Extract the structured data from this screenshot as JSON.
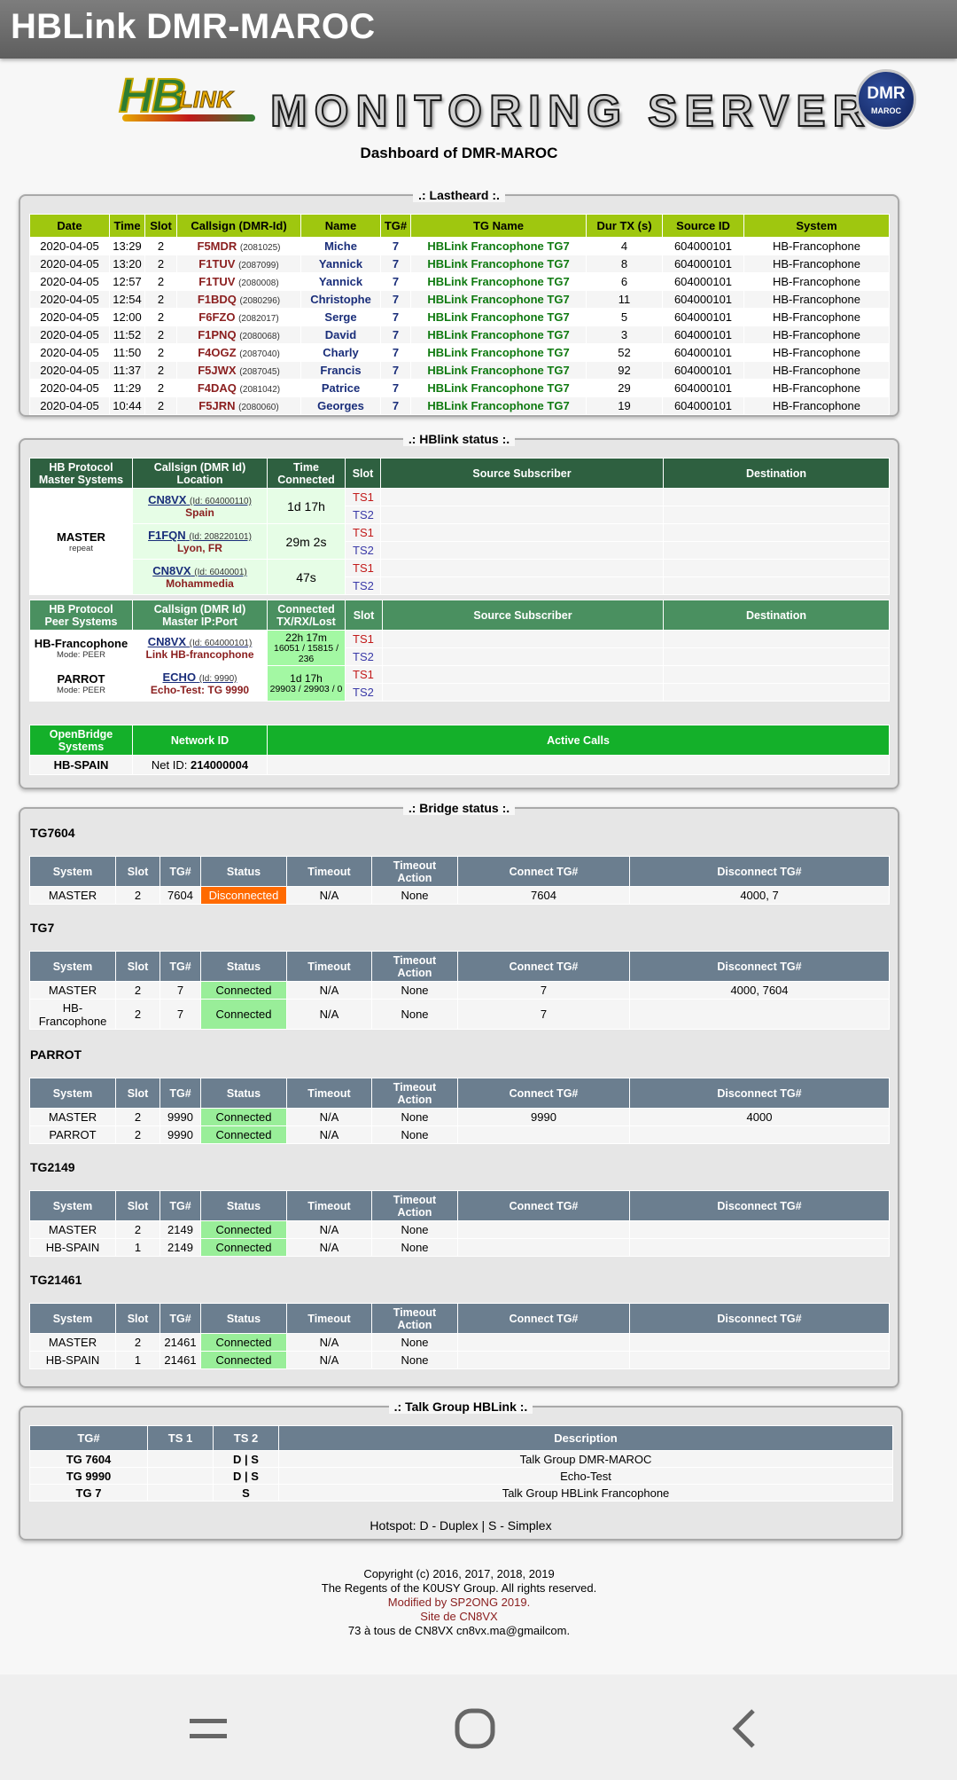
{
  "app_title": "HBLink DMR-MAROC",
  "header": {
    "logo_hb": "HB",
    "logo_link": "LINK",
    "banner": "MONITORING SERVER",
    "badge_top": "DMR",
    "badge_bottom": "MAROC",
    "dashboard_title": "Dashboard of DMR-MAROC"
  },
  "lastheard": {
    "legend": ".: Lastheard :.",
    "columns": [
      "Date",
      "Time",
      "Slot",
      "Callsign (DMR-Id)",
      "Name",
      "TG#",
      "TG Name",
      "Dur TX (s)",
      "Source ID",
      "System"
    ],
    "rows": [
      {
        "date": "2020-04-05",
        "time": "13:29",
        "slot": "2",
        "call": "F5MDR",
        "id": "(2081025)",
        "name": "Miche",
        "tg": "7",
        "tgname": "HBLink Francophone TG7",
        "dur": "4",
        "src": "604000101",
        "sys": "HB-Francophone"
      },
      {
        "date": "2020-04-05",
        "time": "13:20",
        "slot": "2",
        "call": "F1TUV",
        "id": "(2087099)",
        "name": "Yannick",
        "tg": "7",
        "tgname": "HBLink Francophone TG7",
        "dur": "8",
        "src": "604000101",
        "sys": "HB-Francophone"
      },
      {
        "date": "2020-04-05",
        "time": "12:57",
        "slot": "2",
        "call": "F1TUV",
        "id": "(2080008)",
        "name": "Yannick",
        "tg": "7",
        "tgname": "HBLink Francophone TG7",
        "dur": "6",
        "src": "604000101",
        "sys": "HB-Francophone"
      },
      {
        "date": "2020-04-05",
        "time": "12:54",
        "slot": "2",
        "call": "F1BDQ",
        "id": "(2080296)",
        "name": "Christophe",
        "tg": "7",
        "tgname": "HBLink Francophone TG7",
        "dur": "11",
        "src": "604000101",
        "sys": "HB-Francophone"
      },
      {
        "date": "2020-04-05",
        "time": "12:00",
        "slot": "2",
        "call": "F6FZO",
        "id": "(2082017)",
        "name": "Serge",
        "tg": "7",
        "tgname": "HBLink Francophone TG7",
        "dur": "5",
        "src": "604000101",
        "sys": "HB-Francophone"
      },
      {
        "date": "2020-04-05",
        "time": "11:52",
        "slot": "2",
        "call": "F1PNQ",
        "id": "(2080068)",
        "name": "David",
        "tg": "7",
        "tgname": "HBLink Francophone TG7",
        "dur": "3",
        "src": "604000101",
        "sys": "HB-Francophone"
      },
      {
        "date": "2020-04-05",
        "time": "11:50",
        "slot": "2",
        "call": "F4OGZ",
        "id": "(2087040)",
        "name": "Charly",
        "tg": "7",
        "tgname": "HBLink Francophone TG7",
        "dur": "52",
        "src": "604000101",
        "sys": "HB-Francophone"
      },
      {
        "date": "2020-04-05",
        "time": "11:37",
        "slot": "2",
        "call": "F5JWX",
        "id": "(2087045)",
        "name": "Francis",
        "tg": "7",
        "tgname": "HBLink Francophone TG7",
        "dur": "92",
        "src": "604000101",
        "sys": "HB-Francophone"
      },
      {
        "date": "2020-04-05",
        "time": "11:29",
        "slot": "2",
        "call": "F4DAQ",
        "id": "(2081042)",
        "name": "Patrice",
        "tg": "7",
        "tgname": "HBLink Francophone TG7",
        "dur": "29",
        "src": "604000101",
        "sys": "HB-Francophone"
      },
      {
        "date": "2020-04-05",
        "time": "10:44",
        "slot": "2",
        "call": "F5JRN",
        "id": "(2080060)",
        "name": "Georges",
        "tg": "7",
        "tgname": "HBLink Francophone TG7",
        "dur": "19",
        "src": "604000101",
        "sys": "HB-Francophone"
      }
    ]
  },
  "hbstatus": {
    "legend": ".: HBlink status :.",
    "master_headers": {
      "c1a": "HB Protocol",
      "c1b": "Master Systems",
      "c2a": "Callsign (DMR Id)",
      "c2b": "Location",
      "c3a": "Time",
      "c3b": "Connected",
      "c4": "Slot",
      "c5": "Source Subscriber",
      "c6": "Destination"
    },
    "master_name": "MASTER",
    "master_sub": "repeat",
    "masters": [
      {
        "call": "CN8VX",
        "id": "(Id: 604000110)",
        "loc": "Spain",
        "time": "1d 17h"
      },
      {
        "call": "F1FQN",
        "id": "(Id: 208220101)",
        "loc": "Lyon, FR",
        "time": "29m 2s"
      },
      {
        "call": "CN8VX",
        "id": "(Id: 6040001)",
        "loc": "Mohammedia",
        "time": "47s"
      }
    ],
    "ts1": "TS1",
    "ts2": "TS2",
    "peer_headers": {
      "c1a": "HB Protocol",
      "c1b": "Peer Systems",
      "c2a": "Callsign (DMR Id)",
      "c2b": "Master IP:Port",
      "c3a": "Connected",
      "c3b": "TX/RX/Lost",
      "c4": "Slot",
      "c5": "Source Subscriber",
      "c6": "Destination"
    },
    "peers": [
      {
        "name": "HB-Francophone",
        "mode": "Mode: PEER",
        "call": "CN8VX",
        "id": "(Id: 604000101)",
        "loc": "Link HB-francophone",
        "time": "22h 17m",
        "stats": "16051 / 15815 / 236"
      },
      {
        "name": "PARROT",
        "mode": "Mode: PEER",
        "call": "ECHO",
        "id": "(Id: 9990)",
        "loc": "Echo-Test: TG 9990",
        "time": "1d 17h",
        "stats": "29903 / 29903 / 0"
      }
    ],
    "ob_headers": {
      "c1a": "OpenBridge",
      "c1b": "Systems",
      "c2": "Network ID",
      "c3": "Active Calls"
    },
    "ob_row": {
      "name": "HB-SPAIN",
      "net_label": "Net ID: ",
      "net_id": "214000004"
    }
  },
  "bridge": {
    "legend": ".: Bridge status :.",
    "headers": {
      "system": "System",
      "slot": "Slot",
      "tg": "TG#",
      "status": "Status",
      "timeout": "Timeout",
      "action_a": "Timeout",
      "action_b": "Action",
      "connect": "Connect TG#",
      "disconnect": "Disconnect TG#"
    },
    "groups": [
      {
        "name": "TG7604",
        "rows": [
          {
            "system": "MASTER",
            "slot": "2",
            "tg": "7604",
            "status": "Disconnected",
            "timeout": "N/A",
            "action": "None",
            "connect": "7604",
            "disconnect": "4000, 7"
          }
        ]
      },
      {
        "name": "TG7",
        "rows": [
          {
            "system": "MASTER",
            "slot": "2",
            "tg": "7",
            "status": "Connected",
            "timeout": "N/A",
            "action": "None",
            "connect": "7",
            "disconnect": "4000, 7604"
          },
          {
            "system": "HB-Francophone",
            "slot": "2",
            "tg": "7",
            "status": "Connected",
            "timeout": "N/A",
            "action": "None",
            "connect": "7",
            "disconnect": ""
          }
        ]
      },
      {
        "name": "PARROT",
        "rows": [
          {
            "system": "MASTER",
            "slot": "2",
            "tg": "9990",
            "status": "Connected",
            "timeout": "N/A",
            "action": "None",
            "connect": "9990",
            "disconnect": "4000"
          },
          {
            "system": "PARROT",
            "slot": "2",
            "tg": "9990",
            "status": "Connected",
            "timeout": "N/A",
            "action": "None",
            "connect": "",
            "disconnect": ""
          }
        ]
      },
      {
        "name": "TG2149",
        "rows": [
          {
            "system": "MASTER",
            "slot": "2",
            "tg": "2149",
            "status": "Connected",
            "timeout": "N/A",
            "action": "None",
            "connect": "",
            "disconnect": ""
          },
          {
            "system": "HB-SPAIN",
            "slot": "1",
            "tg": "2149",
            "status": "Connected",
            "timeout": "N/A",
            "action": "None",
            "connect": "",
            "disconnect": ""
          }
        ]
      },
      {
        "name": "TG21461",
        "rows": [
          {
            "system": "MASTER",
            "slot": "2",
            "tg": "21461",
            "status": "Connected",
            "timeout": "N/A",
            "action": "None",
            "connect": "",
            "disconnect": ""
          },
          {
            "system": "HB-SPAIN",
            "slot": "1",
            "tg": "21461",
            "status": "Connected",
            "timeout": "N/A",
            "action": "None",
            "connect": "",
            "disconnect": ""
          }
        ]
      }
    ]
  },
  "talkgroup": {
    "legend": ".: Talk Group HBLink :.",
    "columns": [
      "TG#",
      "TS 1",
      "TS 2",
      "Description"
    ],
    "rows": [
      {
        "tg": "TG 7604",
        "ts1": "",
        "ts2": "D | S",
        "desc": "Talk Group DMR-MAROC"
      },
      {
        "tg": "TG 9990",
        "ts1": "",
        "ts2": "D | S",
        "desc": "Echo-Test"
      },
      {
        "tg": "TG 7",
        "ts1": "",
        "ts2": "S",
        "desc": "Talk Group HBLink Francophone"
      }
    ],
    "hotspot": "Hotspot: D - Duplex | S - Simplex"
  },
  "footer": {
    "l1": "Copyright (c) 2016, 2017, 2018, 2019",
    "l2": "The Regents of the K0USY Group. All rights reserved.",
    "l3": "Modified by SP2ONG 2019.",
    "l4": "Site de CN8VX",
    "l5": "73 à tous de CN8VX cn8vx.ma@gmailcom."
  },
  "nav": {
    "menu_icon": "menu-icon",
    "home_icon": "home-icon",
    "back_icon": "back-icon"
  },
  "colors": {
    "lastheard_header": "#9fc70f",
    "master_header": "#2e6040",
    "peer_header": "#4a9060",
    "openbridge_header": "#14b02a",
    "bridge_header": "#6b7e8f",
    "disconnected": "#ff6a00",
    "connected": "#99ee99"
  }
}
